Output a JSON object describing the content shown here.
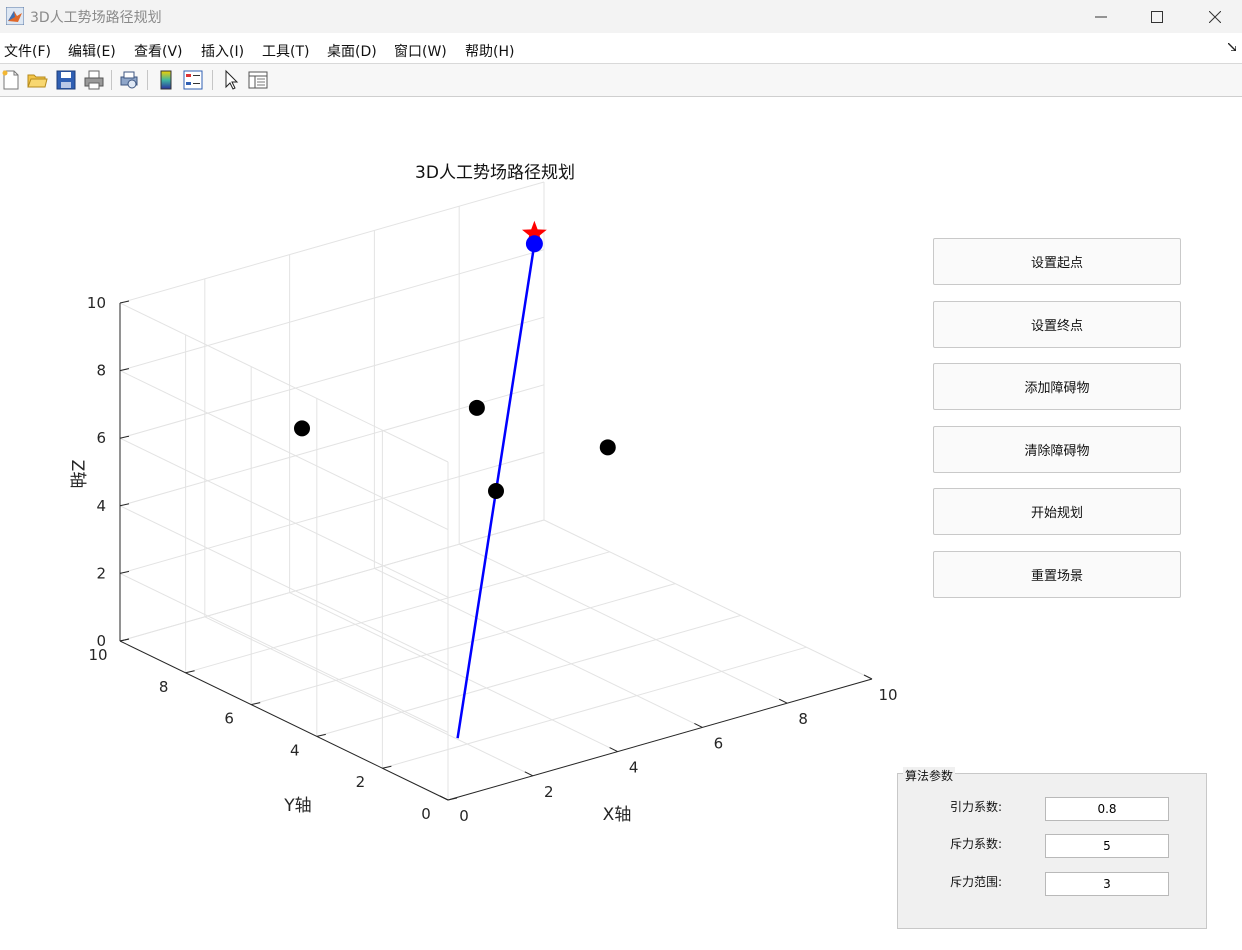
{
  "window": {
    "title": "3D人工势场路径规划",
    "controls": {
      "minimize": "—",
      "maximize": "☐",
      "close": "✕"
    }
  },
  "menu": {
    "items": [
      "文件(F)",
      "编辑(E)",
      "查看(V)",
      "插入(I)",
      "工具(T)",
      "桌面(D)",
      "窗口(W)",
      "帮助(H)"
    ]
  },
  "toolbar": {
    "icons": [
      "new-file-icon",
      "open-folder-icon",
      "save-icon",
      "print-icon",
      "print-preview-icon",
      "colorbar-icon",
      "legend-icon",
      "pointer-icon",
      "property-inspector-icon"
    ]
  },
  "chart_data": {
    "type": "scatter3d",
    "title": "3D人工势场路径规划",
    "xlabel": "X轴",
    "ylabel": "Y轴",
    "zlabel": "Z轴",
    "xlim": [
      0,
      10
    ],
    "ylim": [
      0,
      10
    ],
    "zlim": [
      0,
      10
    ],
    "x_ticks": [
      "0",
      "2",
      "4",
      "6",
      "8",
      "10"
    ],
    "y_ticks": [
      "0",
      "2",
      "4",
      "6",
      "8",
      "10"
    ],
    "z_ticks": [
      "0",
      "2",
      "4",
      "6",
      "8",
      "10"
    ],
    "grid": true,
    "obstacles": [
      {
        "x": 2.9,
        "y": 8.2,
        "z": 6.1
      },
      {
        "x": 5.0,
        "y": 5.0,
        "z": 5.0
      },
      {
        "x": 5.4,
        "y": 6.1,
        "z": 6.8
      },
      {
        "x": 8.1,
        "y": 5.6,
        "z": 4.9
      }
    ],
    "path": {
      "start": {
        "x": 1.0,
        "y": 1.0,
        "z": 1.0
      },
      "end": {
        "x": 9.0,
        "y": 9.0,
        "z": 9.0
      }
    },
    "colors": {
      "path": "#0000ff",
      "goal": "#ff0000",
      "start": "#0000ff",
      "obstacle": "#000000"
    }
  },
  "buttons": {
    "set_start": "设置起点",
    "set_goal": "设置终点",
    "add_obstacle": "添加障碍物",
    "clear_obstacles": "清除障碍物",
    "start_planning": "开始规划",
    "reset_scene": "重置场景"
  },
  "params": {
    "title": "算法参数",
    "attract_label": "引力系数:",
    "attract_value": "0.8",
    "repulse_label": "斥力系数:",
    "repulse_value": "5",
    "range_label": "斥力范围:",
    "range_value": "3"
  }
}
